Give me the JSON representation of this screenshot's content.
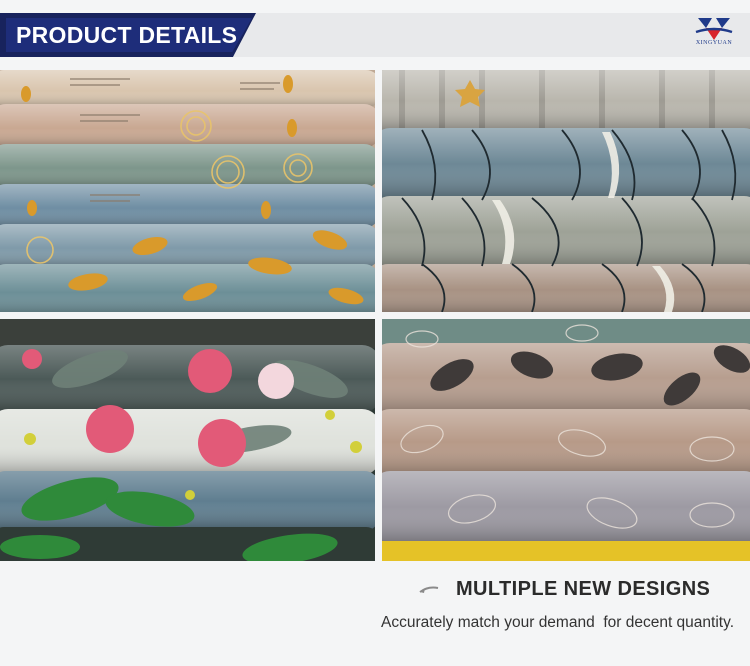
{
  "header": {
    "title": "PRODUCT DETAILS",
    "brand": {
      "name": "XINGYUAN",
      "logo_icon": "xingyuan-logo-icon",
      "colors": {
        "primary": "#1f3a8a",
        "accent": "#d8232a"
      }
    },
    "colors": {
      "tab": "#18235d",
      "band": "#e8e9eb",
      "text": "#ffffff"
    }
  },
  "gallery": {
    "panels": [
      {
        "id": "tl",
        "subject": "gold-cutlery-and-leaf-print-rolls"
      },
      {
        "id": "tr",
        "subject": "wave-line-print-rolls"
      },
      {
        "id": "bl",
        "subject": "tropical-hibiscus-print-rolls"
      },
      {
        "id": "br",
        "subject": "skeleton-leaf-print-rolls"
      }
    ]
  },
  "footer": {
    "heading": "MULTIPLE NEW DESIGNS",
    "tagline": "Accurately match your demand  for decent quantity.",
    "arrow_icon": "swoosh-arrow-icon"
  }
}
